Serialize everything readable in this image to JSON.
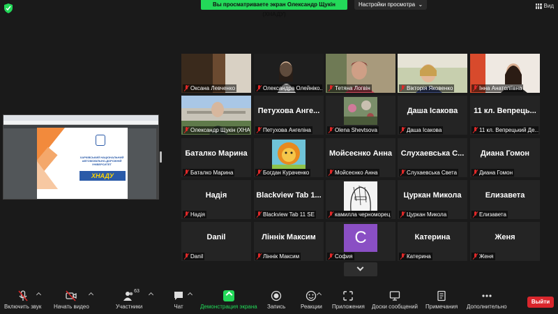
{
  "topbar": {
    "banner_text": "Вы просматриваете экран Олександр Щукін (ХНАДУ)",
    "view_settings_label": "Настройки просмотра",
    "view_label": "Вид"
  },
  "shared_screen": {
    "slide_university": "ХАРКІВСЬКИЙ НАЦІОНАЛЬНИЙ АВТОМОБІЛЬНО-ДОРОЖНІЙ УНІВЕРСИТЕТ",
    "slide_logo_text": "ХНАДУ"
  },
  "participants": [
    {
      "name": "Оксана Левченко",
      "big": ""
    },
    {
      "name": "Олександра Олейніко...",
      "big": ""
    },
    {
      "name": "Тетяна Логвін",
      "big": ""
    },
    {
      "name": "Вікторія Яковенко",
      "big": ""
    },
    {
      "name": "Інна Анатоліївна",
      "big": ""
    },
    {
      "name": "Олександр Щукін (ХНАДУ)",
      "big": ""
    },
    {
      "name": "Петухова Ангеліна",
      "big": "Петухова Анге..."
    },
    {
      "name": "Olena Shevtsova",
      "big": ""
    },
    {
      "name": "Даша Ісакова",
      "big": "Даша Ісакова"
    },
    {
      "name": "11 кл. Вепрецький Де...",
      "big": "11 кл. Вепрець..."
    },
    {
      "name": "Баталко Марина",
      "big": "Баталко Марина"
    },
    {
      "name": "Богдан Кураченко",
      "big": ""
    },
    {
      "name": "Мойсеєнко Анна",
      "big": "Мойсеєнко Анна"
    },
    {
      "name": "Слухаевська Света",
      "big": "Слухаевська С..."
    },
    {
      "name": "Диана Гомон",
      "big": "Диана Гомон"
    },
    {
      "name": "Надія",
      "big": "Надія"
    },
    {
      "name": "Blackview Tab 11 SE",
      "big": "Blackview Tab 1..."
    },
    {
      "name": "камилла черноморец",
      "big": ""
    },
    {
      "name": "Цуркан Микола",
      "big": "Цуркан Микола"
    },
    {
      "name": "Елизавета",
      "big": "Елизавета"
    },
    {
      "name": "Danil",
      "big": "Danil"
    },
    {
      "name": "Ліннік Максим",
      "big": "Ліннік Максим"
    },
    {
      "name": "София",
      "big": ""
    },
    {
      "name": "Катерина",
      "big": "Катерина"
    },
    {
      "name": "Женя",
      "big": "Женя"
    }
  ],
  "sofia_avatar_letter": "С",
  "toolbar": {
    "unmute": "Включить звук",
    "start_video": "Начать видео",
    "participants": "Участники",
    "participants_count": "63",
    "chat": "Чат",
    "share_screen": "Демонстрация экрана",
    "record": "Запись",
    "reactions": "Реакции",
    "apps": "Приложения",
    "whiteboards": "Доски сообщений",
    "notes": "Примечания",
    "more": "Дополнительно",
    "leave": "Выйти"
  },
  "colors": {
    "accent_green": "#23d959",
    "leave_red": "#d9262c",
    "active_speaker": "#e5e532",
    "sofia_avatar": "#8a4fc4"
  }
}
